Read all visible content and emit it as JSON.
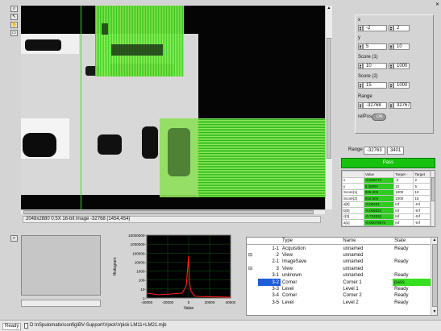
{
  "colors": {
    "green": "#2ecc1f",
    "pass": "#16c20e",
    "selected": "#1c5dd8"
  },
  "image": {
    "status_text": "2048x2880 0.5X 16-bit image -32768    (1454,454)"
  },
  "params": {
    "x_label": "x",
    "x_min": "-2",
    "x_max": "2",
    "y_label": "y",
    "y_min": "5",
    "y_max": "10",
    "score1_label": "Score (1)",
    "score1_min": "10",
    "score1_max": "1000",
    "score2_label": "Score (2)",
    "score2_min": "15",
    "score2_max": "1000",
    "range_label": "Range",
    "range_min": "-32768",
    "range_max": "32767",
    "relpos_label": "relPos",
    "relpos_toggle": "ON"
  },
  "range_readout": {
    "label": "Range",
    "min": "-32763",
    "max": "3401"
  },
  "pass_label": "Pass",
  "results": {
    "headers": [
      "",
      "Value",
      "Target -",
      "Target"
    ],
    "rows": [
      [
        "x",
        "-0.829774",
        "-2",
        "2"
      ],
      [
        "y",
        "9.39097",
        "10",
        "5"
      ],
      [
        "Score(1)",
        "506.003",
        "1000",
        "10"
      ],
      [
        "Score(2)",
        "816.504",
        "1000",
        "15"
      ],
      [
        "a[0]",
        "-0.00484",
        "Inf",
        "-Inf"
      ],
      [
        "b[0]",
        "-0.005823",
        "Inf",
        "-Inf"
      ],
      [
        "c[0]",
        "-0.724532",
        "Inf",
        "-Inf"
      ],
      [
        "a[1]",
        "-0.00079674",
        "Inf",
        "-Inf"
      ],
      [
        "b[1]",
        "0.000956",
        "Inf",
        "-Inf"
      ],
      [
        "c[1]",
        "-0.76351",
        "Inf",
        "-Inf"
      ]
    ]
  },
  "histogram": {
    "ylabel": "Histogram",
    "xlabel": "Value",
    "yticks": [
      "10000000-",
      "1000000-",
      "100000-",
      "10000-",
      "1000-",
      "100-",
      "10-",
      "1-"
    ],
    "xticks": [
      "-40000",
      "-20000",
      "0",
      "20000",
      "40000"
    ]
  },
  "steps": {
    "headers": [
      "",
      "Type",
      "Name",
      "State"
    ],
    "rows": [
      {
        "exp": "",
        "id": "1-1",
        "type": "Acquisition",
        "name": "unnamed",
        "state": "Ready",
        "sel": false,
        "pass": false
      },
      {
        "exp": "⊟",
        "id": "2",
        "type": "View",
        "name": "unnamed",
        "state": "",
        "sel": false,
        "pass": false
      },
      {
        "exp": "",
        "id": "2-1",
        "type": "ImageSave",
        "name": "unnamed",
        "state": "Ready",
        "sel": false,
        "pass": false
      },
      {
        "exp": "⊟",
        "id": "3",
        "type": "View",
        "name": "unnamed",
        "state": "",
        "sel": false,
        "pass": false
      },
      {
        "exp": "",
        "id": "3-1",
        "type": "unknown",
        "name": "unnamed",
        "state": "Ready",
        "sel": false,
        "pass": false
      },
      {
        "exp": "",
        "id": "3-2",
        "type": "Corner",
        "name": "Corner 1",
        "state": "pass",
        "sel": true,
        "pass": true
      },
      {
        "exp": "",
        "id": "3-3",
        "type": "Level",
        "name": "Level 1",
        "state": "Ready",
        "sel": false,
        "pass": false
      },
      {
        "exp": "",
        "id": "3-4",
        "type": "Corner",
        "name": "Corner 2",
        "state": "Ready",
        "sel": false,
        "pass": false
      },
      {
        "exp": "",
        "id": "3-5",
        "type": "Level",
        "name": "Level 2",
        "state": "Ready",
        "sel": false,
        "pass": false
      }
    ]
  },
  "statusbar": {
    "ready": "Ready",
    "path": "D:\\nSpulomatix\\config\\BV-Support\\Vpick\\Vpick LM11+LM21.mjb"
  }
}
